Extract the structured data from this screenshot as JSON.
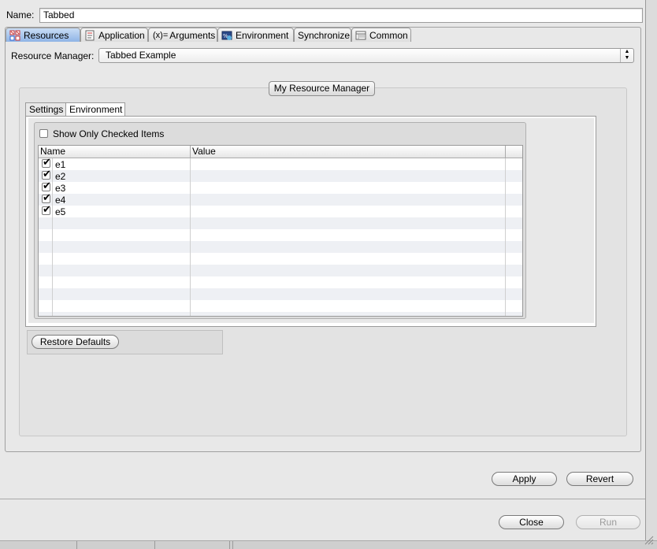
{
  "name_label": "Name:",
  "name_value": "Tabbed",
  "tabs": [
    {
      "label": "Resources",
      "icon": "resources-icon"
    },
    {
      "label": "Application",
      "icon": "application-icon"
    },
    {
      "label": "Arguments",
      "icon": "arguments-icon",
      "icon_text": "(x)="
    },
    {
      "label": "Environment",
      "icon": "environment-icon"
    },
    {
      "label": "Synchronize",
      "icon": ""
    },
    {
      "label": "Common",
      "icon": "common-icon"
    }
  ],
  "active_tab": "Resources",
  "resource_manager_label": "Resource Manager:",
  "resource_manager_value": "Tabbed Example",
  "group_title": "My Resource Manager",
  "inner_tabs": [
    {
      "label": "Settings"
    },
    {
      "label": "Environment"
    }
  ],
  "active_inner_tab": "Environment",
  "show_only_checked_label": "Show Only Checked Items",
  "show_only_checked": false,
  "table": {
    "columns": [
      "Name",
      "Value"
    ],
    "rows": [
      {
        "name": "e1",
        "value": "",
        "checked": true
      },
      {
        "name": "e2",
        "value": "",
        "checked": true
      },
      {
        "name": "e3",
        "value": "",
        "checked": true
      },
      {
        "name": "e4",
        "value": "",
        "checked": true
      },
      {
        "name": "e5",
        "value": "",
        "checked": true
      }
    ]
  },
  "restore_defaults_label": "Restore Defaults",
  "apply_label": "Apply",
  "revert_label": "Revert",
  "close_label": "Close",
  "run_label": "Run",
  "colors": {
    "active_tab": "#8fb4e6",
    "panel_bg": "#e8e8e8",
    "row_alt": "#eef0f4"
  }
}
